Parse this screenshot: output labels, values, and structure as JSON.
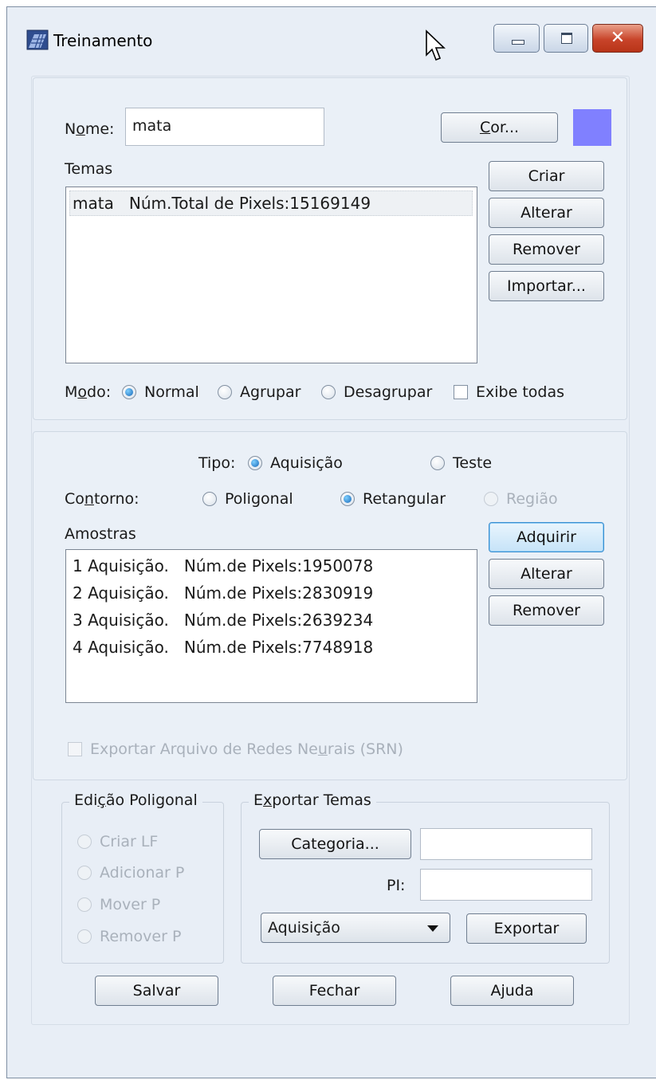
{
  "window": {
    "title": "Treinamento",
    "close_glyph": "✕"
  },
  "icons": {
    "app": "map-grid-icon",
    "cursor": "mouse-pointer-icon"
  },
  "themes": {
    "name_label_pre": "N",
    "name_label_key": "o",
    "name_label_post": "me:",
    "name_value": "mata",
    "color_button_key": "C",
    "color_button_post": "or...",
    "color_swatch": "#8080ff",
    "list_label": "Temas",
    "items": [
      {
        "name": "mata",
        "info": "Núm.Total de Pixels:15169149"
      }
    ],
    "buttons": {
      "create": "Criar",
      "alter": "Alterar",
      "remove": "Remover",
      "import": "Importar..."
    },
    "mode_label_pre": "M",
    "mode_label_key": "o",
    "mode_label_post": "do:",
    "modes": [
      "Normal",
      "Agrupar",
      "Desagrupar"
    ],
    "selected_mode": "Normal",
    "show_all_label": "Exibe todas",
    "show_all_checked": false
  },
  "samples": {
    "type_label": "Tipo:",
    "types": [
      "Aquisição",
      "Teste"
    ],
    "selected_type": "Aquisição",
    "contour_label_pre": "Co",
    "contour_label_key": "n",
    "contour_label_post": "torno:",
    "contours": [
      "Poligonal",
      "Retangular",
      "Região"
    ],
    "selected_contour": "Retangular",
    "list_label": "Amostras",
    "items": [
      {
        "name": "1 Aquisição.",
        "info": "Núm.de Pixels:1950078"
      },
      {
        "name": "2 Aquisição.",
        "info": "Núm.de Pixels:2830919"
      },
      {
        "name": "3 Aquisição.",
        "info": "Núm.de Pixels:2639234"
      },
      {
        "name": "4 Aquisição.",
        "info": "Núm.de Pixels:7748918"
      }
    ],
    "buttons": {
      "acquire": "Adquirir",
      "alter": "Alterar",
      "remove": "Remover"
    },
    "export_nn_pre": "Exportar Arquivo de Redes Ne",
    "export_nn_key": "u",
    "export_nn_post": "rais (SRN)",
    "export_nn_checked": false
  },
  "polygon_edit": {
    "legend_pre": "Edi",
    "legend_key": "ç",
    "legend_post": "ão Poligonal",
    "options": [
      "Criar LF",
      "Adicionar P",
      "Mover P",
      "Remover P"
    ]
  },
  "export_themes": {
    "legend_pre": "E",
    "legend_key": "x",
    "legend_post": "portar Temas",
    "category_button": "Categoria...",
    "category_value": "",
    "pi_label": "PI:",
    "pi_value": "",
    "select_value": "Aquisição",
    "export_button": "Exportar"
  },
  "footer": {
    "save": "Salvar",
    "close": "Fechar",
    "help": "Ajuda"
  }
}
